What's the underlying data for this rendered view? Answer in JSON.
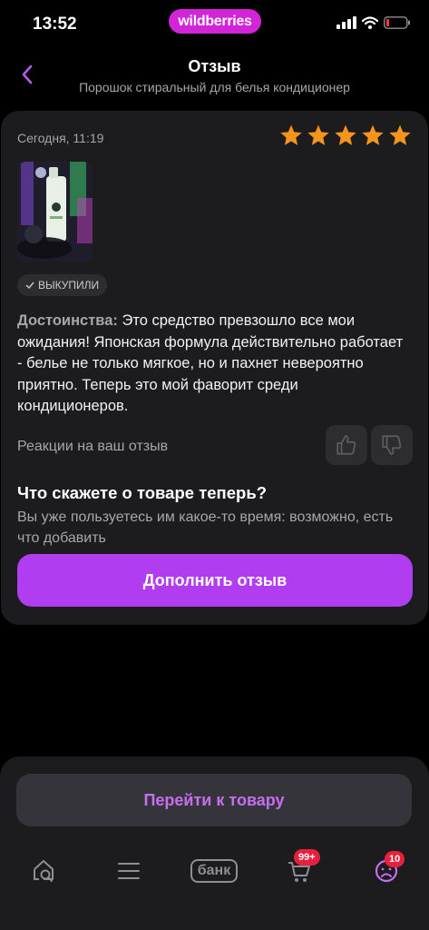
{
  "status_bar": {
    "time": "13:52",
    "brand": "wildberries"
  },
  "header": {
    "title": "Отзыв",
    "subtitle": "Порошок стиральный для белья кондиционер"
  },
  "review": {
    "date": "Сегодня, 11:19",
    "rating": 5,
    "badge": "ВЫКУПИЛИ",
    "advantages_label": "Достоинства:",
    "text": "Это средство превзошло все мои ожидания! Японская формула действительно работает - белье не только мягкое, но и пахнет невероятно приятно. Теперь это мой фаворит среди кондиционеров.",
    "reactions_label": "Реакции на ваш отзыв"
  },
  "followup": {
    "title": "Что скажете о товаре теперь?",
    "text": "Вы уже пользуетесь им какое-то время: возможно, есть что добавить",
    "button_label": "Дополнить отзыв"
  },
  "bottom": {
    "goto_label": "Перейти к товару",
    "nav": {
      "home_icon": "home-search-icon",
      "catalog_icon": "menu-icon",
      "bank_label": "банк",
      "cart_badge": "99+",
      "profile_badge": "10"
    }
  },
  "colors": {
    "accent": "#b03ef0",
    "star": "#f7941d",
    "brand": "#d325d8",
    "badge_red": "#e8203c"
  }
}
